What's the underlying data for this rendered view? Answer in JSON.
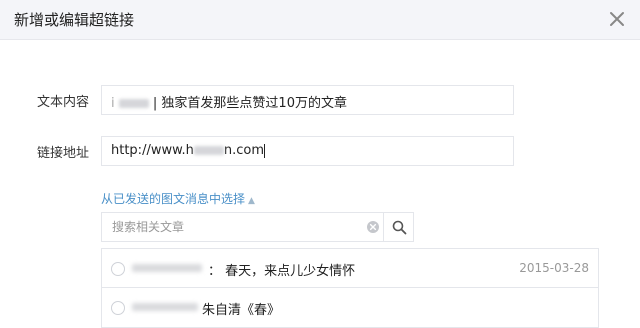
{
  "dialog": {
    "title": "新增或编辑超链接",
    "close_icon": "close-icon"
  },
  "form": {
    "text_label": "文本内容",
    "text_value": "| 独家首发那些点赞过10万的文章",
    "link_label": "链接地址",
    "link_value_prefix": "http://www.h",
    "link_value_suffix": "n.com"
  },
  "picker": {
    "link_text": "从已发送的图文消息中选择",
    "arrow_icon": "caret-up-icon",
    "search_placeholder": "搜索相关文章",
    "clear_icon": "clear-circle-icon",
    "search_icon": "search-icon"
  },
  "articles": [
    {
      "title": "：  春天，来点儿少女情怀",
      "date": "2015-03-28"
    },
    {
      "title": "朱自清《春》",
      "date": ""
    }
  ],
  "colors": {
    "header_bg": "#f4f5f9",
    "link": "#4a90c8",
    "border": "#e4e6eb"
  }
}
